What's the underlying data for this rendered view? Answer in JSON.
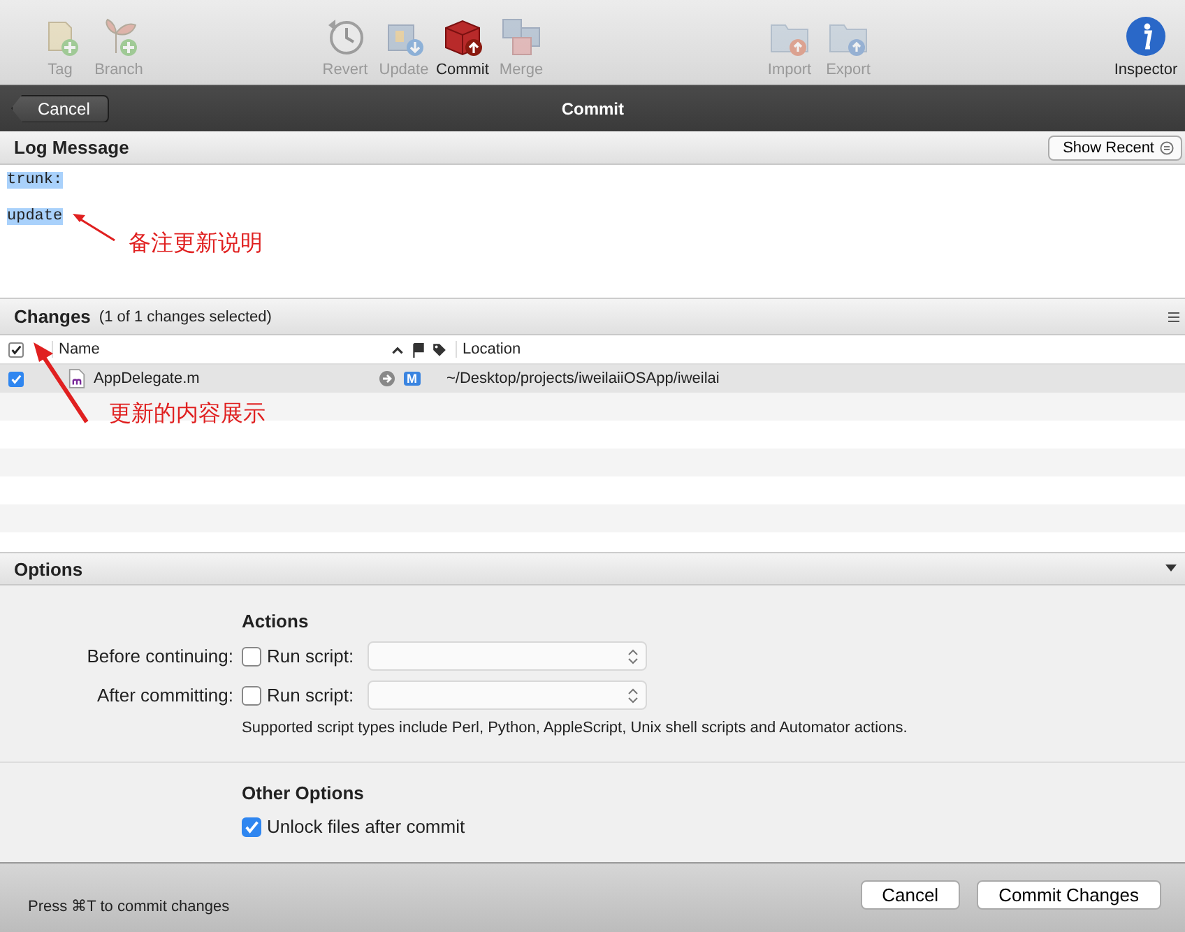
{
  "toolbar": {
    "groups": [
      [
        {
          "label": "Tag",
          "kind": "tag",
          "disabled": true
        },
        {
          "label": "Branch",
          "kind": "branch",
          "disabled": true
        }
      ],
      [
        {
          "label": "Revert",
          "kind": "revert",
          "disabled": true
        },
        {
          "label": "Update",
          "kind": "update",
          "disabled": true
        },
        {
          "label": "Commit",
          "kind": "commit",
          "disabled": false
        },
        {
          "label": "Merge",
          "kind": "merge",
          "disabled": true
        }
      ],
      [
        {
          "label": "Import",
          "kind": "import",
          "disabled": true
        },
        {
          "label": "Export",
          "kind": "export",
          "disabled": true
        }
      ],
      [
        {
          "label": "Inspector",
          "kind": "inspector",
          "disabled": false
        }
      ]
    ]
  },
  "nav_bar": {
    "back_button": "Cancel",
    "title": "Commit"
  },
  "log_message": {
    "title": "Log Message",
    "show_recent_button": "Show Recent",
    "text": "trunk:\n\nupdate",
    "selected": true
  },
  "changes": {
    "title": "Changes",
    "summary": "(1 of 1 changes selected)",
    "all_checked": true,
    "columns": [
      "Name",
      "Location"
    ],
    "rows": [
      {
        "checked": true,
        "name": "AppDelegate.m",
        "status": "M",
        "location": "~/Desktop/projects/iweilaiiOSApp/iweilai"
      }
    ]
  },
  "options": {
    "title": "Options",
    "actions_title": "Actions",
    "actions": [
      {
        "label": "Before continuing:",
        "checked": false,
        "checkbox_label": "Run script:"
      },
      {
        "label": "After committing:",
        "checked": false,
        "checkbox_label": "Run script:"
      }
    ],
    "note": "Supported script types include Perl, Python, AppleScript, Unix shell scripts and Automator actions.",
    "other_title": "Other Options",
    "other": [
      {
        "label": "Unlock files after commit",
        "checked": true
      }
    ]
  },
  "footer": {
    "hint": "Press ⌘T to commit changes",
    "buttons": [
      "Cancel",
      "Commit Changes"
    ]
  },
  "annotations": [
    "备注更新说明",
    "更新的内容展示"
  ]
}
